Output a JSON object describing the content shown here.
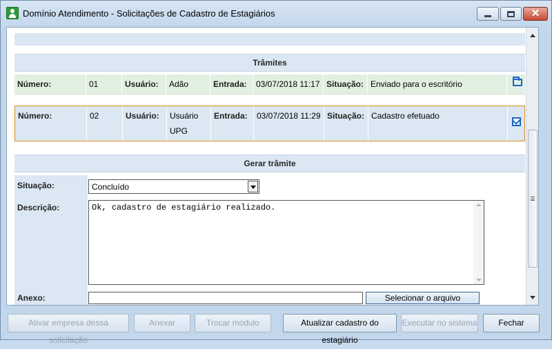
{
  "window": {
    "title": "Domínio Atendimento - Solicitações de Cadastro de Estagiários"
  },
  "tramites": {
    "header": "Trâmites",
    "rows": [
      {
        "numero_label": "Número:",
        "numero": "01",
        "usuario_label": "Usuário:",
        "usuario": "Adão",
        "entrada_label": "Entrada:",
        "entrada": "03/07/2018 11:17",
        "situacao_label": "Situação:",
        "situacao": "Enviado para o escritório",
        "icon": "folder-icon"
      },
      {
        "numero_label": "Número:",
        "numero": "02",
        "usuario_label": "Usuário:",
        "usuario": "Usuário UPG",
        "entrada_label": "Entrada:",
        "entrada": "03/07/2018 11:29",
        "situacao_label": "Situação:",
        "situacao": "Cadastro efetuado",
        "icon": "checkbox-icon",
        "selected": true
      }
    ]
  },
  "gerar": {
    "header": "Gerar trâmite",
    "situacao_label": "Situação:",
    "situacao_value": "Concluído",
    "descricao_label": "Descrição:",
    "descricao_value": "Ok, cadastro de estagiário realizado.",
    "anexo_label": "Anexo:",
    "anexo_value": "",
    "select_file_label": "Selecionar o arquivo"
  },
  "buttons": {
    "ativar": "Ativar empresa dessa solicitação",
    "anexar": "Anexar",
    "trocar": "Trocar módulo",
    "atualizar": "Atualizar cadastro do estagiário",
    "executar": "Executar no sistema",
    "fechar": "Fechar"
  },
  "colors": {
    "selected_border": "#e0891c",
    "row_green": "#e2f0e2",
    "section_blue": "#dbe7f2",
    "icon_blue": "#1b64c4"
  }
}
